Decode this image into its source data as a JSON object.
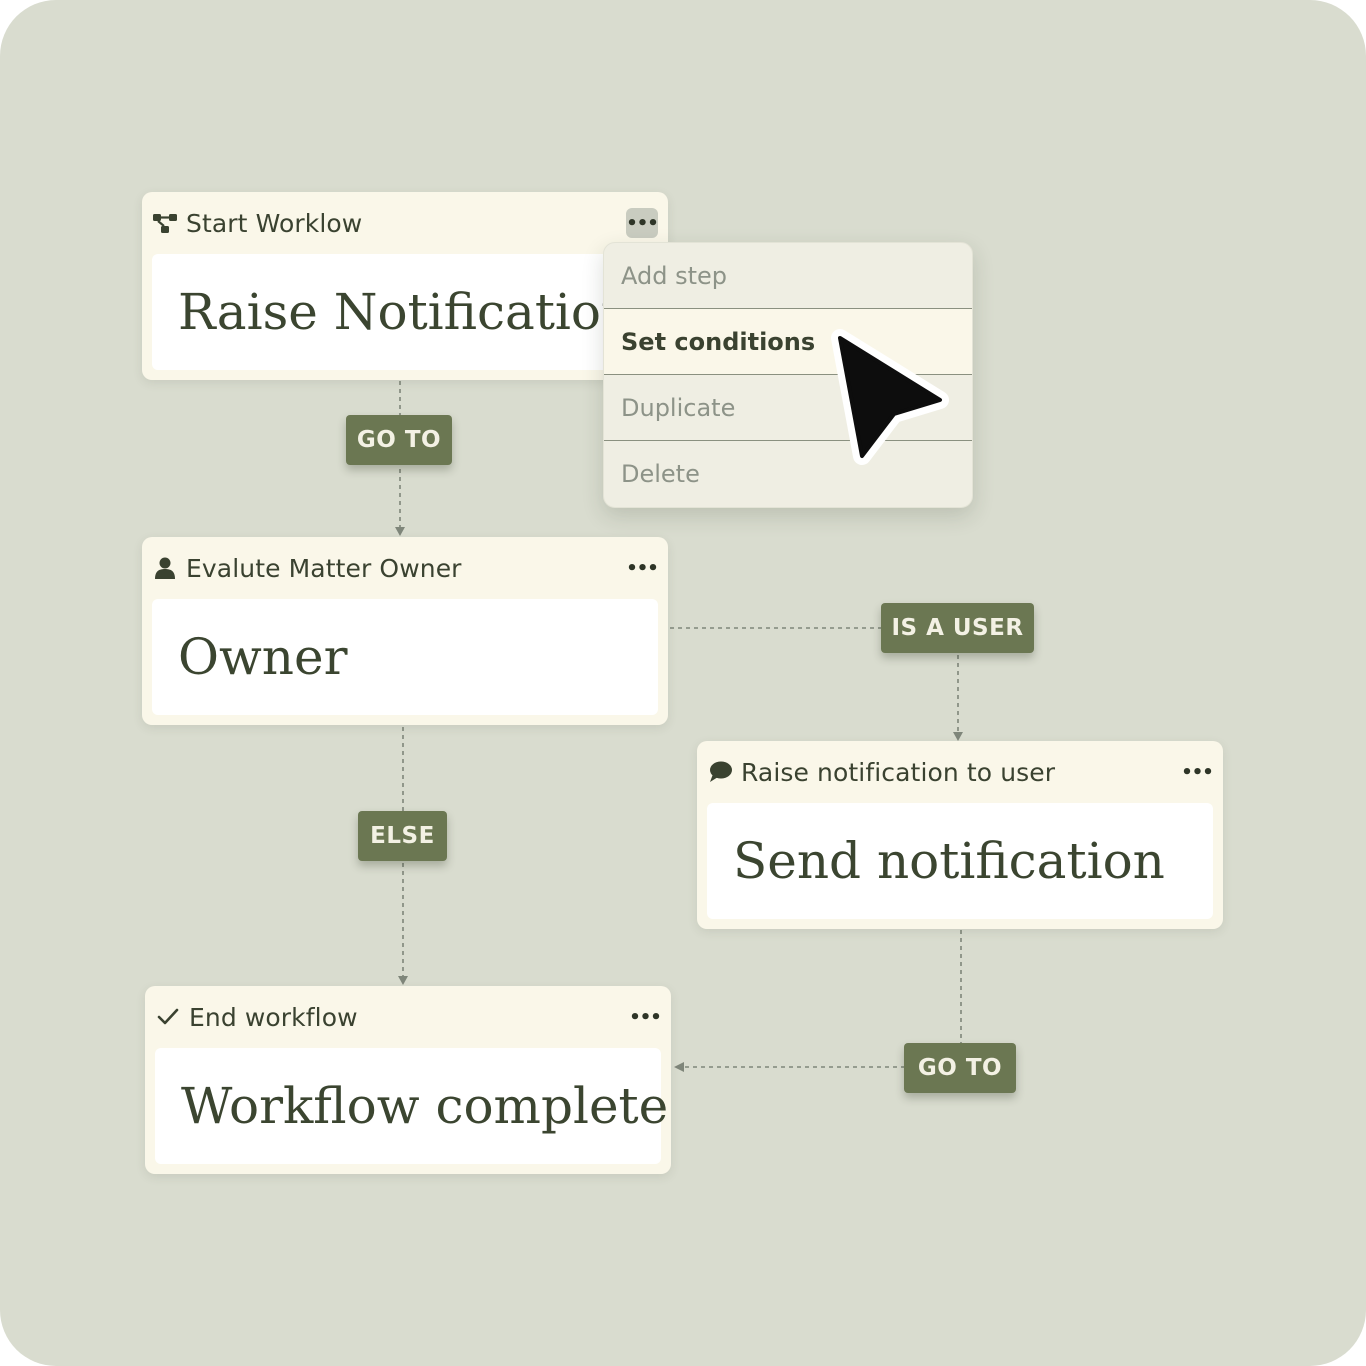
{
  "nodes": [
    {
      "id": "start",
      "title": "Start Worklow",
      "value": "Raise Notification",
      "icon": "workflow-icon"
    },
    {
      "id": "evaluate",
      "title": "Evalute Matter Owner",
      "value": "Owner",
      "icon": "user-icon"
    },
    {
      "id": "notify",
      "title": "Raise notification to user",
      "value": "Send notification",
      "icon": "chat-bubble-icon"
    },
    {
      "id": "end",
      "title": "End workflow",
      "value": "Workflow complete",
      "icon": "checkmark-icon"
    }
  ],
  "menu_glyph": "•••",
  "connectors": {
    "goto_1": "GO TO",
    "is_user": "IS A USER",
    "else": "ELSE",
    "goto_2": "GO TO"
  },
  "context_menu": {
    "items": [
      "Add step",
      "Set conditions",
      "Duplicate",
      "Delete"
    ],
    "highlighted": "Set conditions"
  },
  "colors": {
    "background": "#d9dccf",
    "card": "#faf7e9",
    "tag": "#6b7752",
    "text": "#3a4230"
  }
}
